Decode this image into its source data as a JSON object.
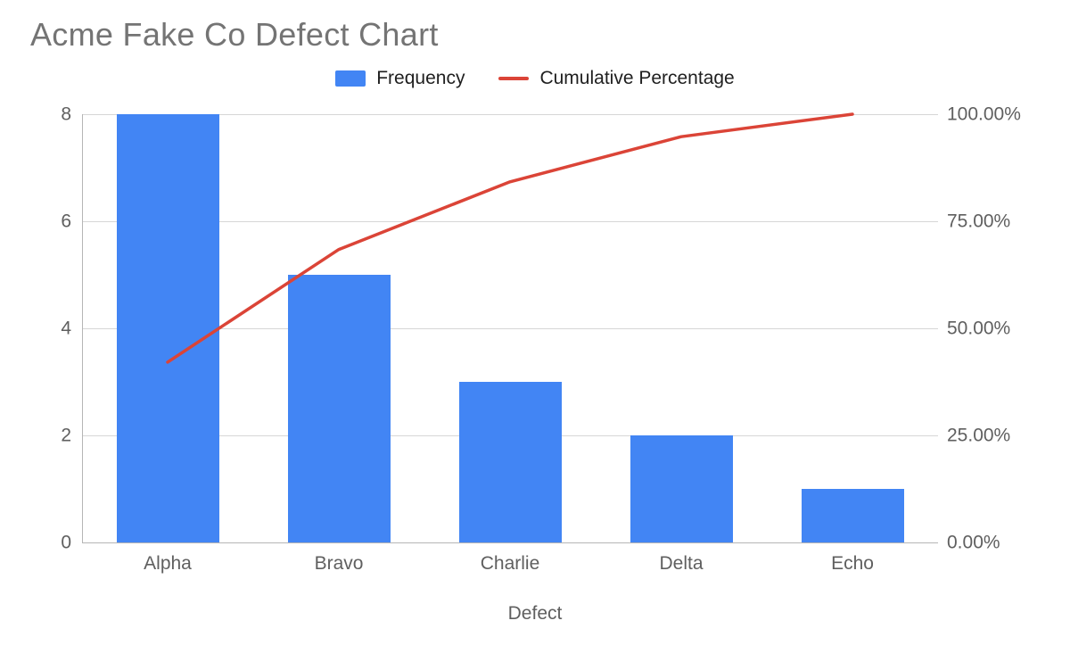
{
  "title": "Acme Fake Co Defect Chart",
  "legend": {
    "frequency": "Frequency",
    "cumulative": "Cumulative Percentage"
  },
  "xaxis_title": "Defect",
  "left_ticks": [
    "0",
    "2",
    "4",
    "6",
    "8"
  ],
  "right_ticks": [
    "0.00%",
    "25.00%",
    "50.00%",
    "75.00%",
    "100.00%"
  ],
  "categories": [
    "Alpha",
    "Bravo",
    "Charlie",
    "Delta",
    "Echo"
  ],
  "colors": {
    "bar": "#4285f4",
    "line": "#db4437",
    "grid": "#d6d6d6",
    "axis": "#b5b5b5"
  },
  "chart_data": {
    "type": "bar",
    "title": "Acme Fake Co Defect Chart",
    "xlabel": "Defect",
    "ylabel_left": "Frequency",
    "ylabel_right": "Cumulative Percentage",
    "categories": [
      "Alpha",
      "Bravo",
      "Charlie",
      "Delta",
      "Echo"
    ],
    "series": [
      {
        "name": "Frequency",
        "type": "bar",
        "axis": "left",
        "values": [
          8,
          5,
          3,
          2,
          1
        ]
      },
      {
        "name": "Cumulative Percentage",
        "type": "line",
        "axis": "right",
        "values": [
          42.11,
          68.42,
          84.21,
          94.74,
          100.0
        ]
      }
    ],
    "ylim_left": [
      0,
      8
    ],
    "ylim_right": [
      0,
      100
    ],
    "legend_position": "top"
  }
}
